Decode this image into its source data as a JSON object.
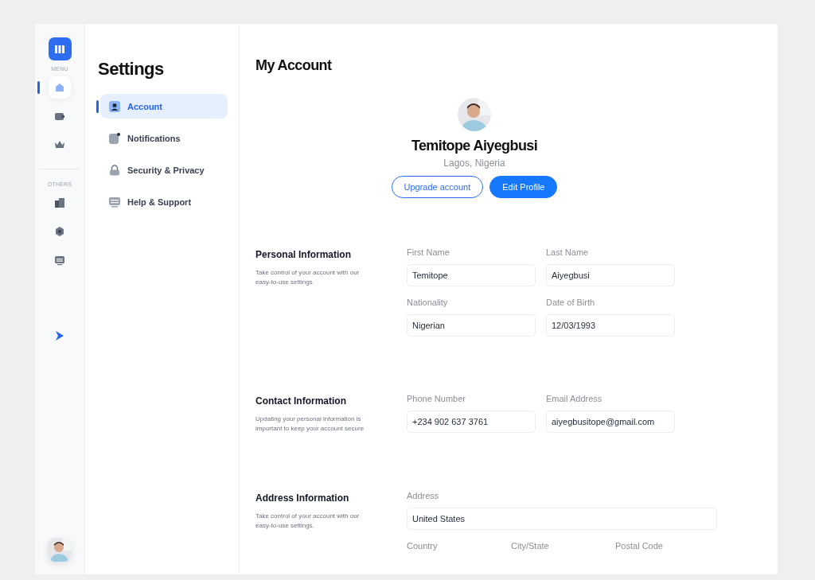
{
  "rail": {
    "menu_label": "MENU",
    "menu_items": [
      {
        "kind": "home",
        "selected": true
      },
      {
        "kind": "wallet",
        "selected": false
      },
      {
        "kind": "crown",
        "selected": false
      }
    ],
    "others_label": "OTHERS",
    "other_items": [
      {
        "kind": "building",
        "selected": false
      },
      {
        "kind": "hexagon",
        "selected": false
      },
      {
        "kind": "monitor",
        "selected": false
      }
    ]
  },
  "settings": {
    "title": "Settings",
    "items": [
      {
        "label": "Account",
        "kind": "user",
        "selected": true
      },
      {
        "label": "Notifications",
        "kind": "bell",
        "selected": false
      },
      {
        "label": "Security & Privacy",
        "kind": "lock",
        "selected": false
      },
      {
        "label": "Help & Support",
        "kind": "help",
        "selected": false
      }
    ]
  },
  "main": {
    "title": "My Account",
    "profile": {
      "name": "Temitope Aiyegbusi",
      "location": "Lagos, Nigeria",
      "buttons": [
        "Upgrade account",
        "Edit Profile"
      ]
    },
    "sections": [
      {
        "title": "Personal Information",
        "description": "Take control of your account with our easy-to-use settings.",
        "fields": [
          {
            "label": "First Name",
            "value": "Temitope"
          },
          {
            "label": "Last Name",
            "value": "Aiyegbusi"
          },
          {
            "label": "Nationality",
            "value": "Nigerian"
          },
          {
            "label": "Date of Birth",
            "value": "12/03/1993"
          }
        ]
      },
      {
        "title": "Contact Information",
        "description": "Updating your personal information is important to keep your account secure",
        "fields": [
          {
            "label": "Phone Number",
            "value": "+234 902 637 3761"
          },
          {
            "label": "Email Address",
            "value": "aiyegbusitope@gmail.com"
          }
        ]
      },
      {
        "title": "Address Information",
        "description": "Take control of your account with our easy-to-use settings.",
        "fields": [
          {
            "label": "Address",
            "value": "United States",
            "kind": "wide"
          },
          {
            "label": "Country",
            "kind": "label"
          },
          {
            "label": "City/State",
            "kind": "label"
          },
          {
            "label": "Postal Code",
            "kind": "label"
          }
        ]
      }
    ]
  }
}
